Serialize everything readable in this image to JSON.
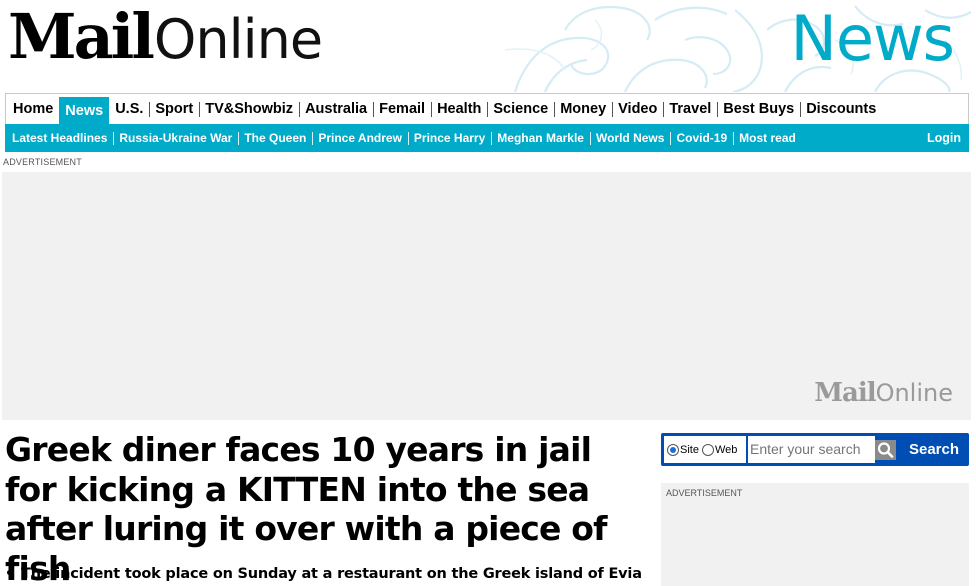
{
  "masthead": {
    "logo_mail": "Mail",
    "logo_online": "Online",
    "channel": "News",
    "accent_color": "#00aac9"
  },
  "nav_primary": [
    {
      "label": "Home",
      "active": false
    },
    {
      "label": "News",
      "active": true
    },
    {
      "label": "U.S.",
      "active": false
    },
    {
      "label": "Sport",
      "active": false
    },
    {
      "label": "TV&Showbiz",
      "active": false
    },
    {
      "label": "Australia",
      "active": false
    },
    {
      "label": "Femail",
      "active": false
    },
    {
      "label": "Health",
      "active": false
    },
    {
      "label": "Science",
      "active": false
    },
    {
      "label": "Money",
      "active": false
    },
    {
      "label": "Video",
      "active": false
    },
    {
      "label": "Travel",
      "active": false
    },
    {
      "label": "Best Buys",
      "active": false
    },
    {
      "label": "Discounts",
      "active": false
    }
  ],
  "nav_secondary": [
    "Latest Headlines",
    "Russia-Ukraine War",
    "The Queen",
    "Prince Andrew",
    "Prince Harry",
    "Meghan Markle",
    "World News",
    "Covid-19",
    "Most read"
  ],
  "login_label": "Login",
  "advertisement": {
    "label": "ADVERTISEMENT",
    "logo_mail": "Mail",
    "logo_online": "Online"
  },
  "article": {
    "headline": "Greek diner faces 10 years in jail for kicking a KITTEN into the sea after luring it over with a piece of fish",
    "bullets": [
      "The incident took place on Sunday at a restaurant on the Greek island of Evia"
    ]
  },
  "search": {
    "option_site": "Site",
    "option_web": "Web",
    "selected": "Site",
    "placeholder": "Enter your search",
    "button_label": "Search",
    "button_color": "#004db3"
  },
  "side_advertisement": {
    "label": "ADVERTISEMENT"
  }
}
